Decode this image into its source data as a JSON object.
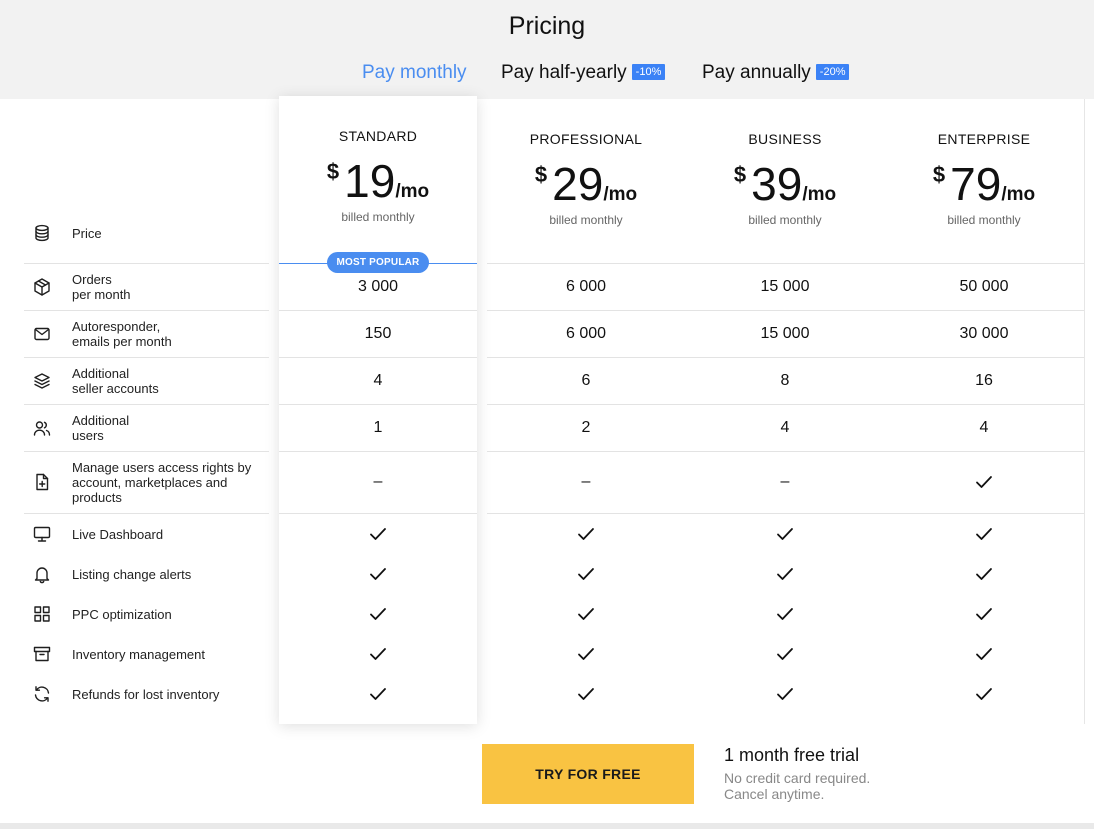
{
  "page": {
    "title": "Pricing"
  },
  "tabs": [
    {
      "label": "Pay monthly",
      "badge": "",
      "active": true
    },
    {
      "label": "Pay half-yearly",
      "badge": "-10%",
      "active": false
    },
    {
      "label": "Pay annually",
      "badge": "-20%",
      "active": false
    }
  ],
  "plans": [
    {
      "name": "STANDARD",
      "currency": "$",
      "price": "19",
      "period": "/mo",
      "billing": "billed monthly",
      "featured_badge": "MOST POPULAR"
    },
    {
      "name": "PROFESSIONAL",
      "currency": "$",
      "price": "29",
      "period": "/mo",
      "billing": "billed monthly"
    },
    {
      "name": "BUSINESS",
      "currency": "$",
      "price": "39",
      "period": "/mo",
      "billing": "billed monthly"
    },
    {
      "name": "ENTERPRISE",
      "currency": "$",
      "price": "79",
      "period": "/mo",
      "billing": "billed monthly"
    }
  ],
  "features": [
    {
      "label": "Price",
      "icon": "coins-icon"
    },
    {
      "label": "Orders\nper month",
      "icon": "package-icon",
      "values": [
        "3 000",
        "6 000",
        "15 000",
        "50 000"
      ]
    },
    {
      "label": "Autoresponder,\nemails per month",
      "icon": "mail-icon",
      "values": [
        "150",
        "6 000",
        "15 000",
        "30 000"
      ]
    },
    {
      "label": "Additional\nseller accounts",
      "icon": "layers-icon",
      "values": [
        "4",
        "6",
        "8",
        "16"
      ]
    },
    {
      "label": "Additional\nusers",
      "icon": "users-icon",
      "values": [
        "1",
        "2",
        "4",
        "4"
      ]
    },
    {
      "label": "Manage users access rights by account, marketplaces and products",
      "icon": "file-plus-icon",
      "values": [
        "–",
        "–",
        "–",
        "check"
      ]
    },
    {
      "label": "Live Dashboard",
      "icon": "monitor-icon",
      "values": [
        "check",
        "check",
        "check",
        "check"
      ]
    },
    {
      "label": "Listing change alerts",
      "icon": "bell-icon",
      "values": [
        "check",
        "check",
        "check",
        "check"
      ]
    },
    {
      "label": "PPC optimization",
      "icon": "grid-icon",
      "values": [
        "check",
        "check",
        "check",
        "check"
      ]
    },
    {
      "label": "Inventory management",
      "icon": "archive-icon",
      "values": [
        "check",
        "check",
        "check",
        "check"
      ]
    },
    {
      "label": "Refunds for lost inventory",
      "icon": "refresh-icon",
      "values": [
        "check",
        "check",
        "check",
        "check"
      ]
    }
  ],
  "cta": {
    "button_label": "TRY FOR FREE",
    "trial_title": "1 month free trial",
    "trial_line1": "No credit card required.",
    "trial_line2": "Cancel anytime."
  },
  "colors": {
    "accent": "#4a8df0",
    "badge": "#3b82f6",
    "cta": "#f9c342",
    "header_bg": "#f2f2f2"
  }
}
